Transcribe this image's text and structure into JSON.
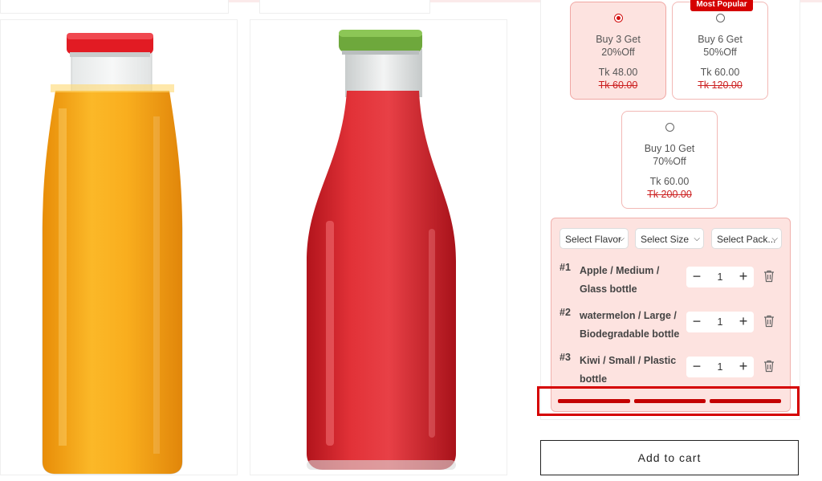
{
  "offers": [
    {
      "title_line1": "Buy 3 Get",
      "title_line2": "20%Off",
      "price": "Tk 48.00",
      "old_price": "Tk 60.00",
      "selected": true
    },
    {
      "title_line1": "Buy 6 Get",
      "title_line2": "50%Off",
      "price": "Tk 60.00",
      "old_price": "Tk 120.00",
      "badge": "Most Popular"
    },
    {
      "title_line1": "Buy 10 Get",
      "title_line2": "70%Off",
      "price": "Tk 60.00",
      "old_price": "Tk 200.00"
    }
  ],
  "selects": {
    "flavor": "Select Flavor",
    "size": "Select Size",
    "pack": "Select Pack..."
  },
  "items": [
    {
      "num": "#1",
      "line1": "Apple / Medium /",
      "line2": "Glass bottle",
      "qty": "1"
    },
    {
      "num": "#2",
      "line1": "watermelon / Large /",
      "line2": "Biodegradable bottle",
      "qty": "1"
    },
    {
      "num": "#3",
      "line1": "Kiwi / Small / Plastic",
      "line2": "bottle",
      "qty": "1"
    }
  ],
  "add_to_cart": "Add to cart",
  "colors": {
    "accent": "#d50000",
    "panel_bg": "#fde3e0",
    "orange_juice": "#f7a51c",
    "red_juice": "#d8262c"
  },
  "icons": {
    "minus": "minus-icon",
    "plus": "plus-icon",
    "trash": "trash-icon",
    "chevron": "chevron-down-icon"
  }
}
